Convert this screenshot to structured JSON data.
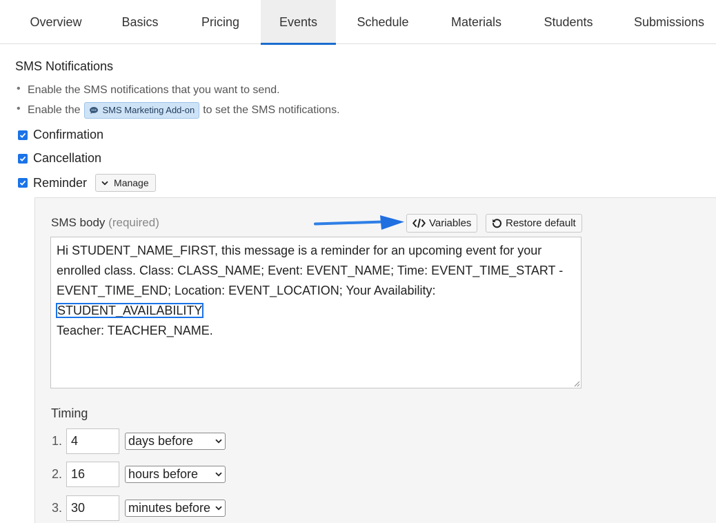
{
  "tabs": [
    {
      "label": "Overview"
    },
    {
      "label": "Basics"
    },
    {
      "label": "Pricing"
    },
    {
      "label": "Events",
      "active": true
    },
    {
      "label": "Schedule"
    },
    {
      "label": "Materials"
    },
    {
      "label": "Students"
    },
    {
      "label": "Submissions"
    }
  ],
  "sms": {
    "title": "SMS Notifications",
    "bullet1": "Enable the SMS notifications that you want to send.",
    "bullet2_before": "Enable the",
    "addon_label": "SMS Marketing Add-on",
    "bullet2_after": "to set the SMS notifications."
  },
  "checks": {
    "confirmation": "Confirmation",
    "cancellation": "Cancellation",
    "reminder": "Reminder",
    "manage_label": "Manage"
  },
  "body": {
    "label": "SMS body",
    "required": "(required)",
    "variables_button": "Variables",
    "restore_button": "Restore default",
    "text_before": "Hi STUDENT_NAME_FIRST, this message is a reminder for an upcoming event for your enrolled class. Class: CLASS_NAME; Event: EVENT_NAME; Time: EVENT_TIME_START - EVENT_TIME_END; Location: EVENT_LOCATION; Your Availability: ",
    "text_highlight": "STUDENT_AVAILABILITY",
    "text_after": "Teacher: TEACHER_NAME."
  },
  "timing": {
    "label": "Timing",
    "rows": [
      {
        "index": "1.",
        "value": "4",
        "unit": "days before"
      },
      {
        "index": "2.",
        "value": "16",
        "unit": "hours before"
      },
      {
        "index": "3.",
        "value": "30",
        "unit": "minutes before"
      }
    ]
  },
  "colors": {
    "accent": "#1a73e8",
    "active_tab_bg": "#eeeeee",
    "panel_bg": "#f5f5f5",
    "pill_bg": "#cfe3f7"
  },
  "icons": {
    "chat": "chat-bubble-icon",
    "chevron": "chevron-down-icon",
    "code": "code-icon",
    "restore": "restore-icon",
    "arrow": "pointer-arrow-icon"
  }
}
